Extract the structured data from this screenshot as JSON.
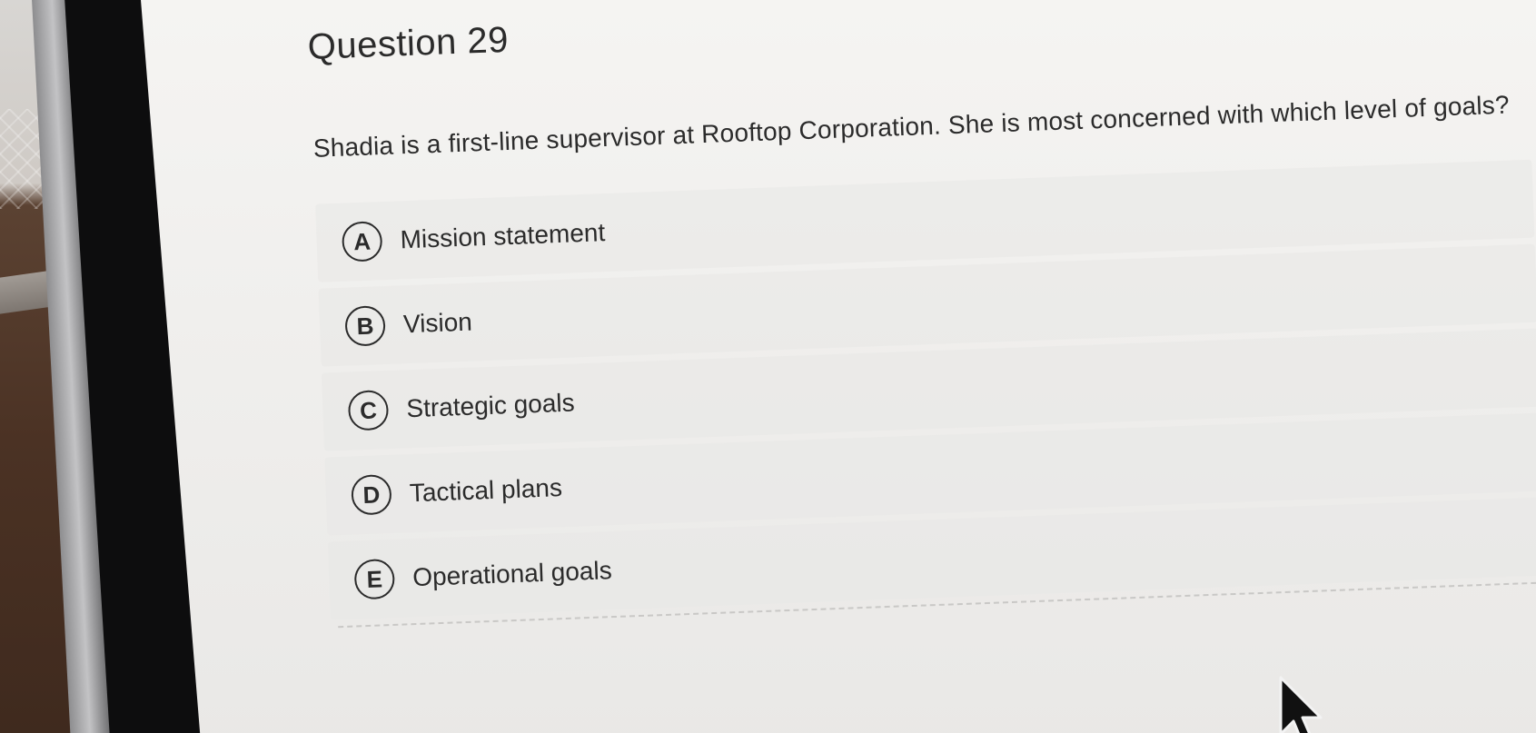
{
  "question": {
    "title": "Question 29",
    "text": "Shadia is a first-line supervisor at Rooftop Corporation. She is most concerned with which level of goals?"
  },
  "options": [
    {
      "letter": "A",
      "label": "Mission statement"
    },
    {
      "letter": "B",
      "label": "Vision"
    },
    {
      "letter": "C",
      "label": "Strategic goals"
    },
    {
      "letter": "D",
      "label": "Tactical plans"
    },
    {
      "letter": "E",
      "label": "Operational goals"
    }
  ],
  "icons": {
    "cursor": "mouse-pointer-icon"
  },
  "colors": {
    "text": "#2b2b2b",
    "screen_bg": "#f2f1ef",
    "bezel": "#0d0d0e"
  }
}
